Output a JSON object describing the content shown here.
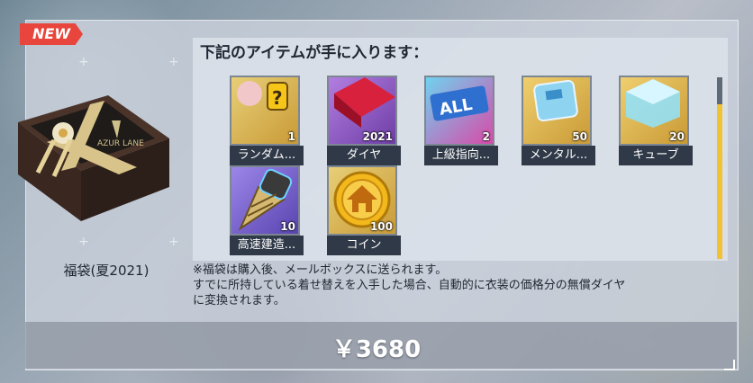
{
  "badge": "NEW",
  "product": {
    "name": "福袋(夏2021)"
  },
  "items_header": "下記のアイテムが手に入ります：",
  "items": [
    {
      "label": "ランダム...",
      "qty": "1",
      "icon": "random-box-icon",
      "color": "#d9b54a"
    },
    {
      "label": "ダイヤ",
      "qty": "2021",
      "icon": "diamond-icon",
      "color": "#9a63c9"
    },
    {
      "label": "上級指向...",
      "qty": "2",
      "icon": "all-blueprint-icon",
      "color": "#4aa8d8"
    },
    {
      "label": "メンタル...",
      "qty": "50",
      "icon": "mental-unit-icon",
      "color": "#e1b84e"
    },
    {
      "label": "キューブ",
      "qty": "20",
      "icon": "cube-icon",
      "color": "#e1b84e"
    },
    {
      "label": "高速建造...",
      "qty": "10",
      "icon": "drill-icon",
      "color": "#7a62c5"
    },
    {
      "label": "コイン",
      "qty": "100",
      "icon": "coin-icon",
      "color": "#d9b54a"
    }
  ],
  "note": {
    "line1": "※福袋は購入後、メールボックスに送られます。",
    "line2": "すでに所持している着せ替えを入手した場合、自動的に衣装の価格分の無償ダイヤ",
    "line3": "に変換されます。"
  },
  "price": "￥3680"
}
